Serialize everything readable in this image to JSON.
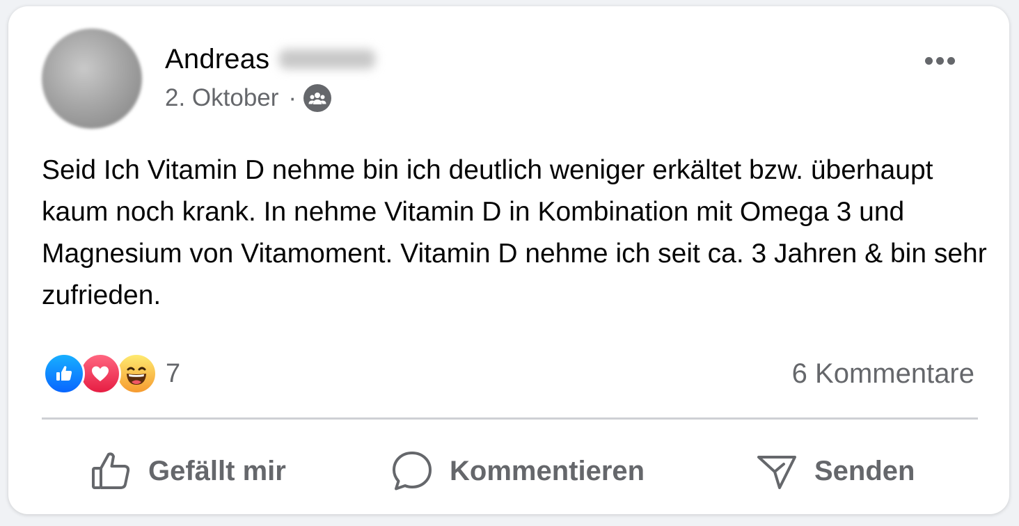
{
  "post": {
    "author": {
      "name": "Andreas",
      "surname_redacted": true
    },
    "date": "2. Oktober",
    "separator": "·",
    "audience_icon": "group-icon",
    "text": "Seid Ich Vitamin D nehme bin ich deutlich weniger erkältet bzw. überhaupt kaum noch krank. In nehme Vitamin D in Kombination mit Omega 3 und Magnesium von Vitamoment. Vitamin D nehme ich seit ca. 3 Jahren & bin sehr zufrieden.",
    "reactions": {
      "types": [
        "like",
        "love",
        "haha"
      ],
      "count": "7"
    },
    "comments_label": "6 Kommentare",
    "actions": {
      "like_label": "Gefällt mir",
      "comment_label": "Kommentieren",
      "send_label": "Senden"
    }
  },
  "colors": {
    "text_primary": "#050505",
    "text_secondary": "#65676b",
    "like_blue": "#0866ff",
    "love_red": "#e61e43",
    "haha_yellow": "#f7b125",
    "divider": "#ced0d4"
  }
}
